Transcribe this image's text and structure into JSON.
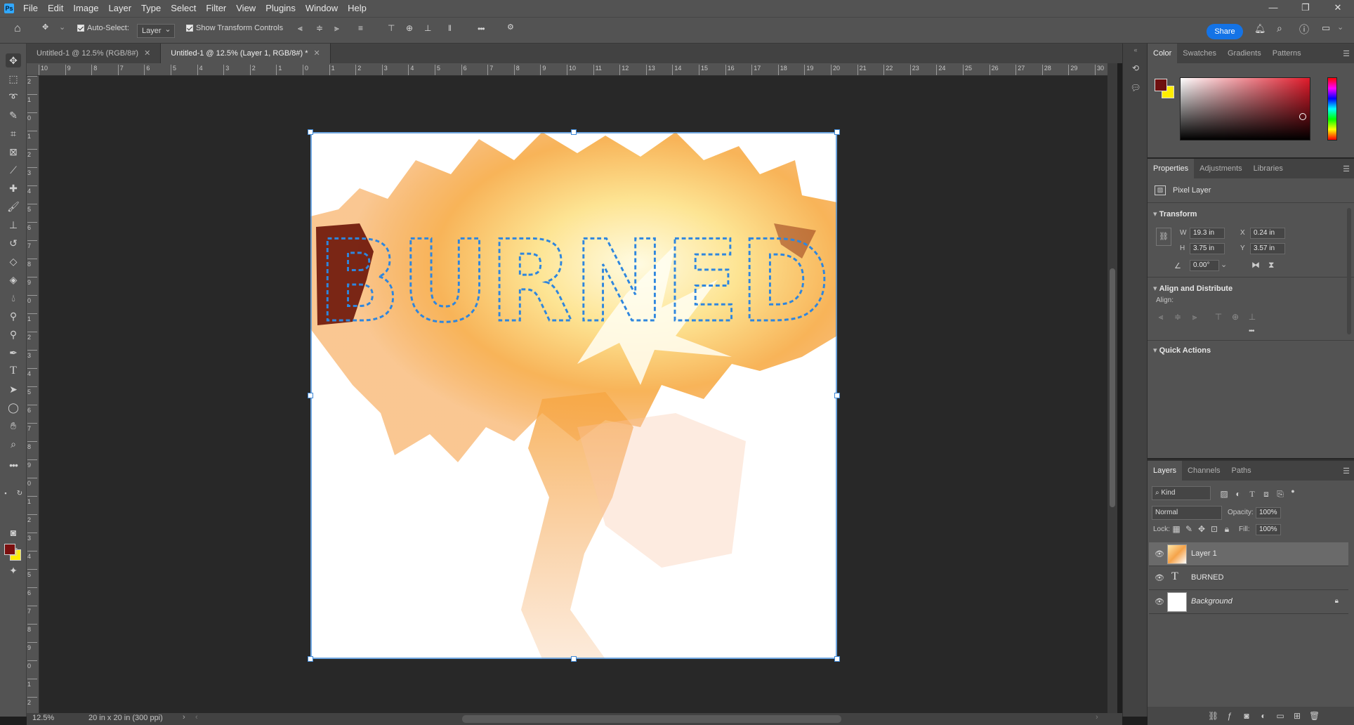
{
  "app": {
    "logo": "Ps"
  },
  "menu": [
    "File",
    "Edit",
    "Image",
    "Layer",
    "Type",
    "Select",
    "Filter",
    "View",
    "Plugins",
    "Window",
    "Help"
  ],
  "window_controls": {
    "minimize": "—",
    "restore": "❐",
    "close": "✕"
  },
  "options_bar": {
    "auto_select_label": "Auto-Select:",
    "auto_select_value": "Layer",
    "show_transform_label": "Show Transform Controls",
    "more": "•••",
    "share_label": "Share"
  },
  "tabs": [
    {
      "label": "Untitled-1 @ 12.5% (RGB/8#)",
      "active": false
    },
    {
      "label": "Untitled-1 @ 12.5% (Layer 1, RGB/8#) *",
      "active": true
    }
  ],
  "ruler_h": [
    "10",
    "9",
    "8",
    "7",
    "6",
    "5",
    "4",
    "3",
    "2",
    "1",
    "0",
    "1",
    "2",
    "3",
    "4",
    "5",
    "6",
    "7",
    "8",
    "9",
    "10",
    "11",
    "12",
    "13",
    "14",
    "15",
    "16",
    "17",
    "18",
    "19",
    "20",
    "21",
    "22",
    "23",
    "24",
    "25",
    "26",
    "27",
    "28",
    "29",
    "30"
  ],
  "ruler_v": [
    "2",
    "1",
    "0",
    "1",
    "2",
    "3",
    "4",
    "5",
    "6",
    "7",
    "8",
    "9",
    "0",
    "1",
    "2",
    "3",
    "4",
    "5",
    "6",
    "7",
    "8",
    "9",
    "0",
    "1",
    "2",
    "3",
    "4",
    "5",
    "6",
    "7",
    "8",
    "9",
    "0",
    "1",
    "2"
  ],
  "canvas": {
    "text": "BURNED",
    "fg_color": "#7a0f0f",
    "bg_color": "#ffee00"
  },
  "status": {
    "zoom": "12.5%",
    "doc_size": "20 in x 20 in (300 ppi)"
  },
  "color_panel": {
    "tabs": [
      "Color",
      "Swatches",
      "Gradients",
      "Patterns"
    ],
    "fg": "#6e0f0f",
    "bg": "#ffee00"
  },
  "properties_panel": {
    "tabs": [
      "Properties",
      "Adjustments",
      "Libraries"
    ],
    "layer_type": "Pixel Layer",
    "transform_title": "Transform",
    "w_label": "W",
    "w_value": "19.3 in",
    "h_label": "H",
    "h_value": "3.75 in",
    "x_label": "X",
    "x_value": "0.24 in",
    "y_label": "Y",
    "y_value": "3.57 in",
    "angle_value": "0.00°",
    "align_title": "Align and Distribute",
    "align_label": "Align:",
    "more": "•••",
    "quick_actions_title": "Quick Actions"
  },
  "layers_panel": {
    "tabs": [
      "Layers",
      "Channels",
      "Paths"
    ],
    "filter_kind": "Kind",
    "blend_mode": "Normal",
    "opacity_label": "Opacity:",
    "opacity_value": "100%",
    "lock_label": "Lock:",
    "fill_label": "Fill:",
    "fill_value": "100%",
    "layers": [
      {
        "name": "Layer 1",
        "selected": true
      },
      {
        "name": "BURNED",
        "selected": false
      },
      {
        "name": "Background",
        "selected": false
      }
    ]
  }
}
